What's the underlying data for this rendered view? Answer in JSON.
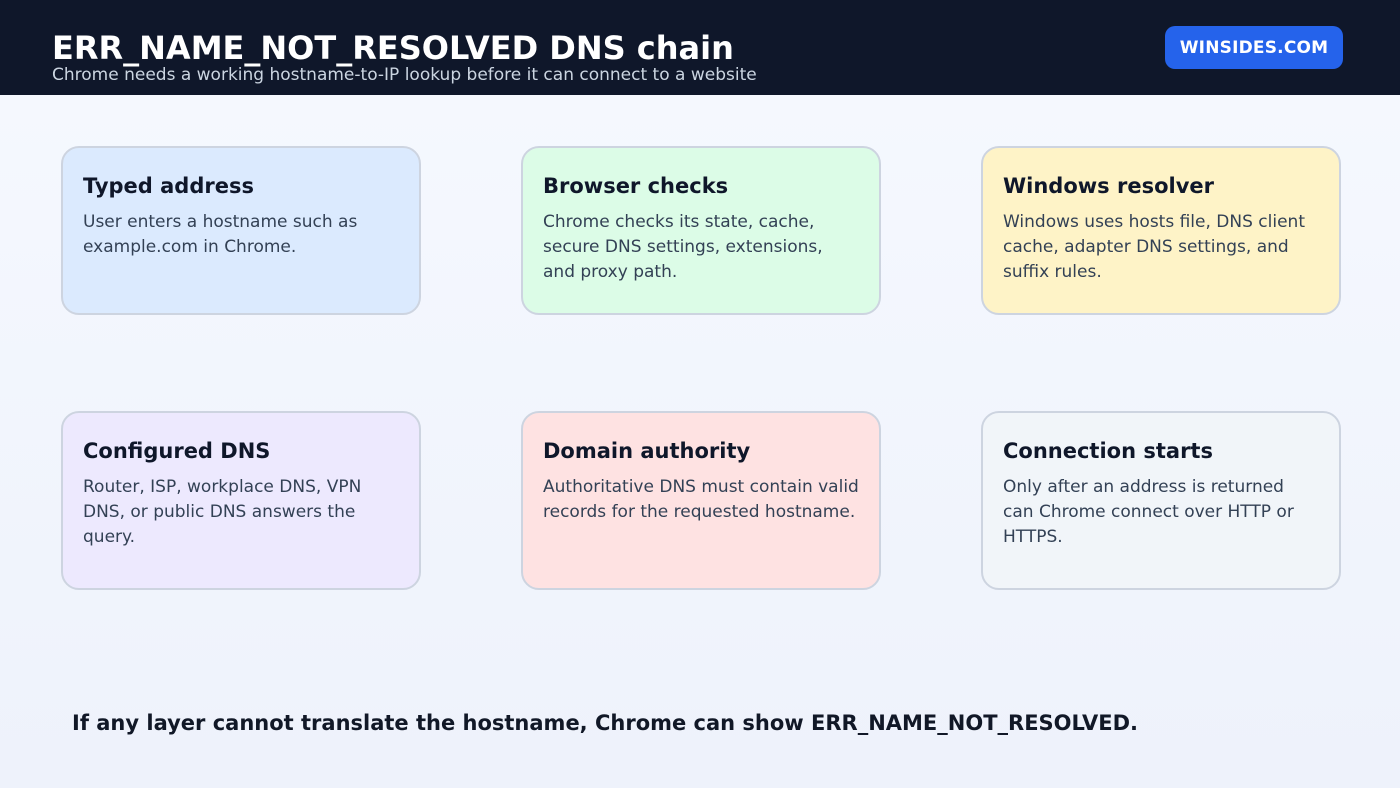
{
  "header": {
    "title": "ERR_NAME_NOT_RESOLVED DNS chain",
    "subtitle": "Chrome needs a working hostname-to-IP lookup before it can connect to a website",
    "brand": "WINSIDES.COM"
  },
  "cards": [
    {
      "title": "Typed address",
      "body": "User enters a hostname such as example.com in Chrome.",
      "color": "#dbeafe"
    },
    {
      "title": "Browser checks",
      "body": "Chrome checks its state, cache, secure DNS settings, extensions, and proxy path.",
      "color": "#dcfce7"
    },
    {
      "title": "Windows resolver",
      "body": "Windows uses hosts file, DNS client cache, adapter DNS settings, and suffix rules.",
      "color": "#fef3c7"
    },
    {
      "title": "Configured DNS",
      "body": "Router, ISP, workplace DNS, VPN DNS, or public DNS answers the query.",
      "color": "#ede9fe"
    },
    {
      "title": "Domain authority",
      "body": "Authoritative DNS must contain valid records for the requested hostname.",
      "color": "#fee2e2"
    },
    {
      "title": "Connection starts",
      "body": "Only after an address is returned can Chrome connect over HTTP or HTTPS.",
      "color": "#f1f5f9"
    }
  ],
  "footer": "If any layer cannot translate the hostname, Chrome can show ERR_NAME_NOT_RESOLVED."
}
